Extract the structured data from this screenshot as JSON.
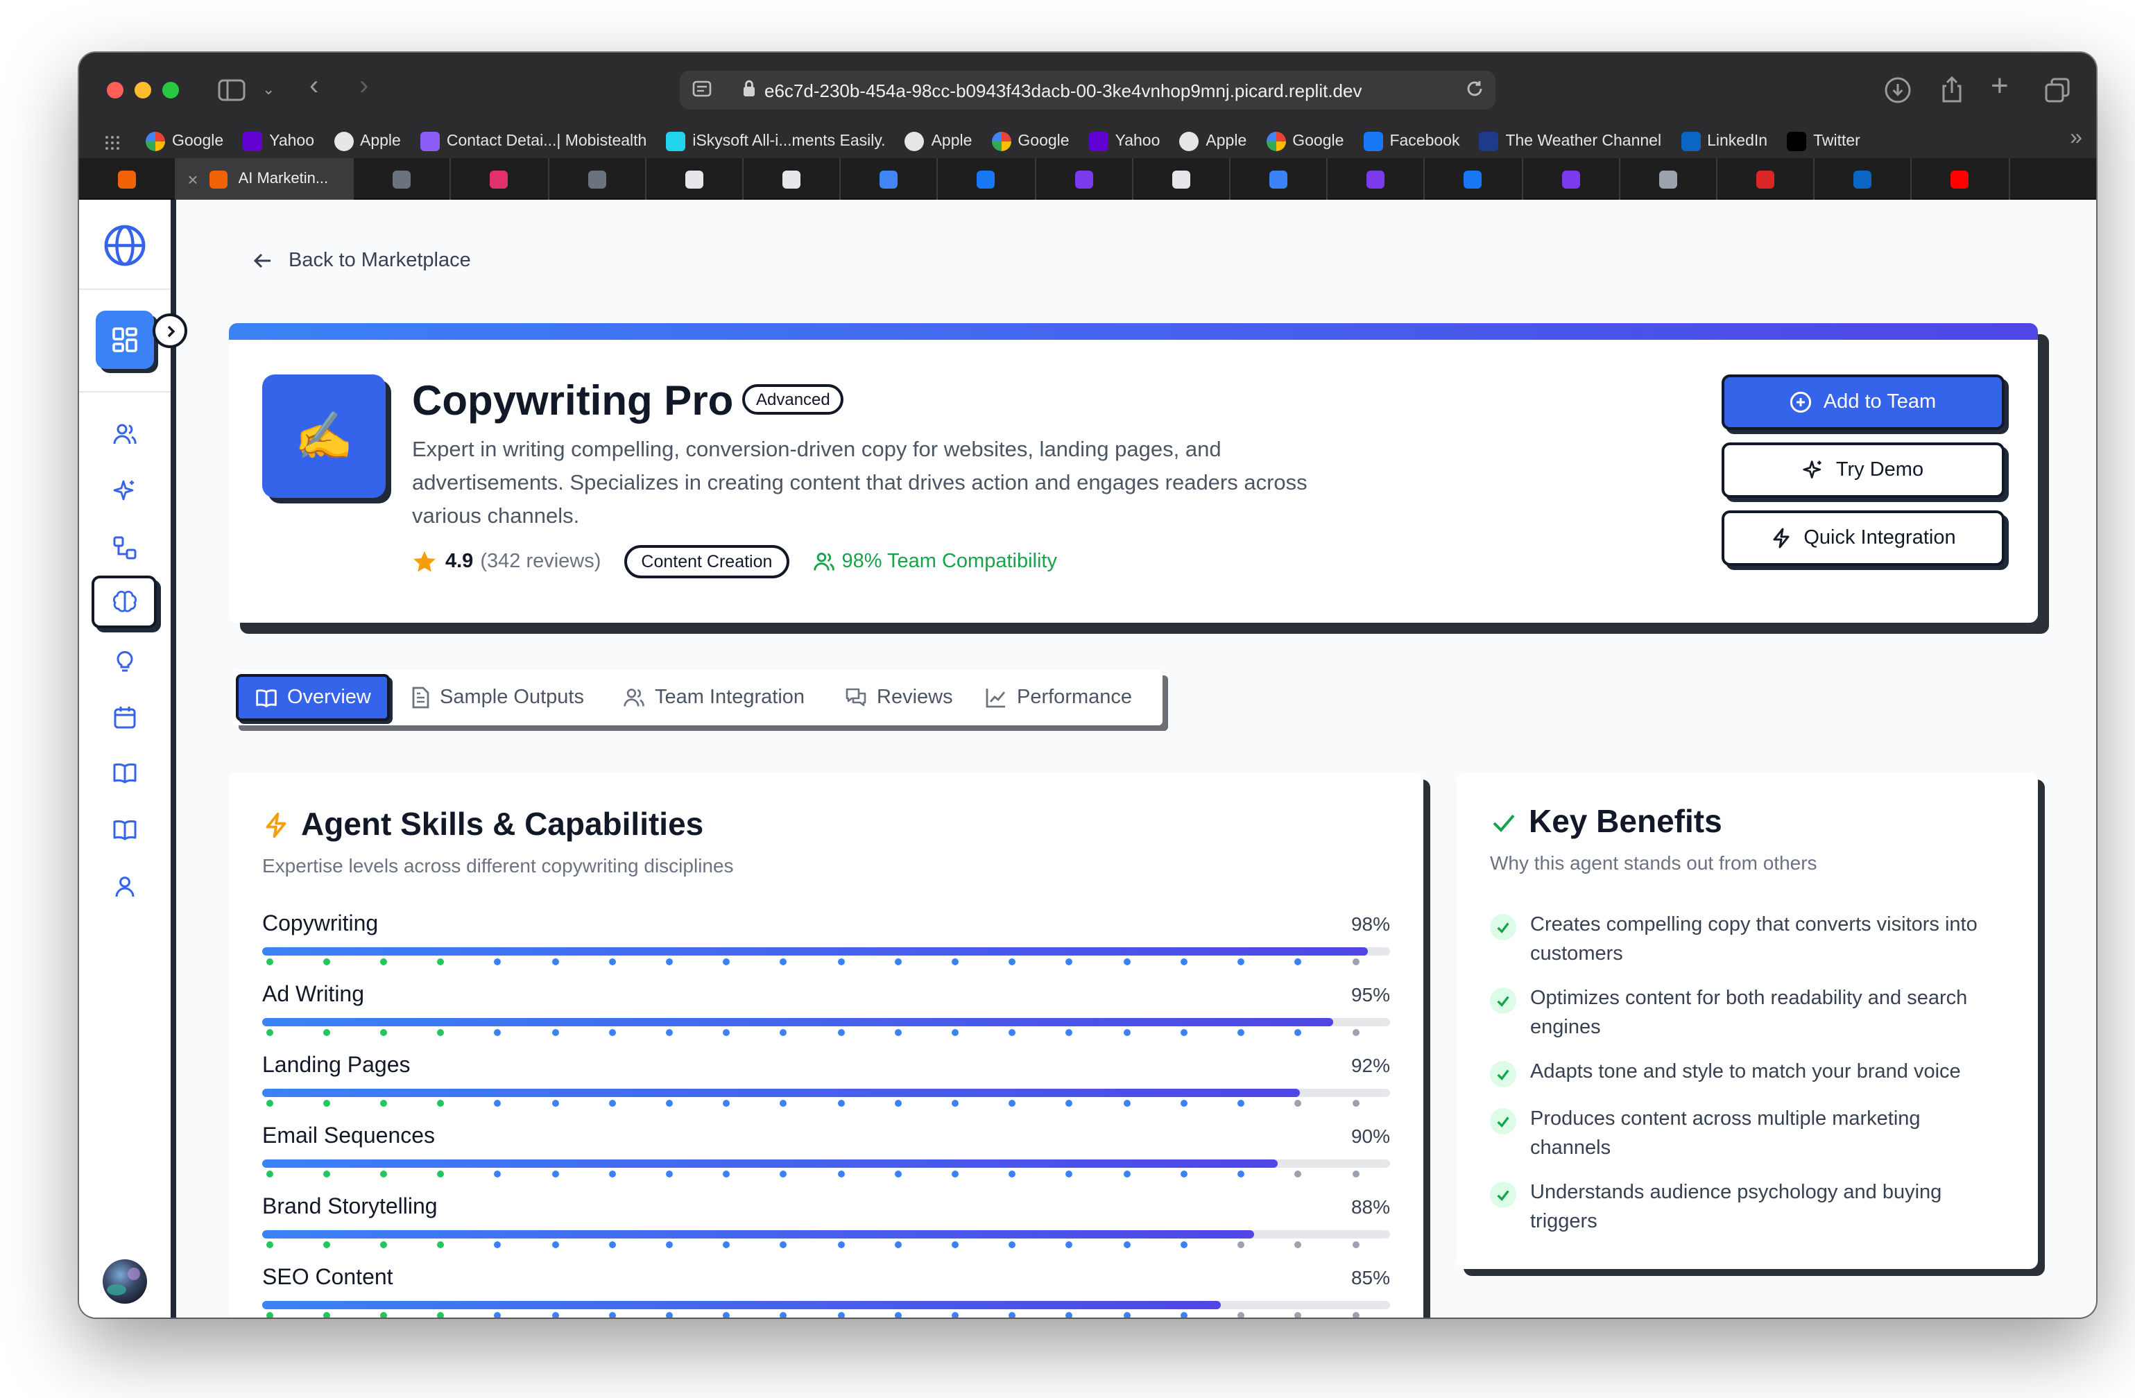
{
  "browser": {
    "url": "e6c7d-230b-454a-98cc-b0943f43dacb-00-3ke4vnhop9mnj.picard.replit.dev",
    "bookmarks": [
      {
        "label": "Google",
        "icon": "google-icon",
        "color": "#ffffff"
      },
      {
        "label": "Yahoo",
        "icon": "yahoo-icon",
        "color": "#6001d2"
      },
      {
        "label": "Apple",
        "icon": "apple-icon",
        "color": "#e6e6e6"
      },
      {
        "label": "Contact Detai...| Mobistealth",
        "icon": "mobistealth-icon",
        "color": "#8b5cf6"
      },
      {
        "label": "iSkysoft All-i...ments Easily.",
        "icon": "iskysoft-icon",
        "color": "#22d3ee"
      },
      {
        "label": "Apple",
        "icon": "apple-icon",
        "color": "#e6e6e6"
      },
      {
        "label": "Google",
        "icon": "google-icon",
        "color": "#ffffff"
      },
      {
        "label": "Yahoo",
        "icon": "yahoo-icon",
        "color": "#6001d2"
      },
      {
        "label": "Apple",
        "icon": "apple-icon",
        "color": "#e6e6e6"
      },
      {
        "label": "Google",
        "icon": "google-icon",
        "color": "#ffffff"
      },
      {
        "label": "Facebook",
        "icon": "facebook-icon",
        "color": "#1877f2"
      },
      {
        "label": "The Weather Channel",
        "icon": "weather-channel-icon",
        "color": "#1e3a8a"
      },
      {
        "label": "LinkedIn",
        "icon": "linkedin-icon",
        "color": "#0a66c2"
      },
      {
        "label": "Twitter",
        "icon": "x-twitter-icon",
        "color": "#000000"
      }
    ],
    "active_tab_label": "AI Marketin...",
    "tab_favicons": [
      {
        "icon": "replit-icon",
        "color": "#f26207"
      },
      {
        "icon": "replit-icon",
        "color": "#f26207"
      },
      {
        "icon": "r-icon",
        "color": "#6b7280"
      },
      {
        "icon": "instagram-icon",
        "color": "#e1306c"
      },
      {
        "icon": "r-icon",
        "color": "#6b7280"
      },
      {
        "icon": "chat-icon",
        "color": "#e5e7eb"
      },
      {
        "icon": "x-icon",
        "color": "#e5e7eb"
      },
      {
        "icon": "docs-icon",
        "color": "#4285f4"
      },
      {
        "icon": "facebook-icon",
        "color": "#1877f2"
      },
      {
        "icon": "pen-icon",
        "color": "#7c3aed"
      },
      {
        "icon": "c-icon",
        "color": "#e5e7eb"
      },
      {
        "icon": "q-icon",
        "color": "#3b82f6"
      },
      {
        "icon": "send-icon",
        "color": "#7c3aed"
      },
      {
        "icon": "facebook-icon",
        "color": "#1877f2"
      },
      {
        "icon": "pen-icon",
        "color": "#7c3aed"
      },
      {
        "icon": "a-icon",
        "color": "#9ca3af"
      },
      {
        "icon": "l-icon",
        "color": "#dc2626"
      },
      {
        "icon": "linkedin-icon",
        "color": "#0a66c2"
      },
      {
        "icon": "youtube-icon",
        "color": "#ff0000"
      }
    ]
  },
  "nav": {
    "back_label": "Back to Marketplace"
  },
  "agent": {
    "icon": "✍️",
    "name": "Copywriting Pro",
    "level": "Advanced",
    "description": "Expert in writing compelling, conversion-driven copy for websites, landing pages, and advertisements. Specializes in creating content that drives action and engages readers across various channels.",
    "rating": "4.9",
    "reviews": "(342 reviews)",
    "category": "Content Creation",
    "compatibility": "98% Team Compatibility"
  },
  "actions": {
    "add_to_team": "Add to Team",
    "try_demo": "Try Demo",
    "quick_integration": "Quick Integration"
  },
  "tabs": [
    "Overview",
    "Sample Outputs",
    "Team Integration",
    "Reviews",
    "Performance"
  ],
  "skills_card": {
    "title": "Agent Skills & Capabilities",
    "subtitle": "Expertise levels across different copywriting disciplines",
    "skills": [
      {
        "name": "Copywriting",
        "value": 98,
        "label": "98%"
      },
      {
        "name": "Ad Writing",
        "value": 95,
        "label": "95%"
      },
      {
        "name": "Landing Pages",
        "value": 92,
        "label": "92%"
      },
      {
        "name": "Email Sequences",
        "value": 90,
        "label": "90%"
      },
      {
        "name": "Brand Storytelling",
        "value": 88,
        "label": "88%"
      },
      {
        "name": "SEO Content",
        "value": 85,
        "label": "85%"
      }
    ]
  },
  "benefits_card": {
    "title": "Key Benefits",
    "subtitle": "Why this agent stands out from others",
    "items": [
      "Creates compelling copy that converts visitors into customers",
      "Optimizes content for both readability and search engines",
      "Adapts tone and style to match your brand voice",
      "Produces content across multiple marketing channels",
      "Understands audience psychology and buying triggers"
    ]
  },
  "colors": {
    "accent": "#3563e9",
    "success": "#16a34a",
    "star": "#f59e0b"
  }
}
